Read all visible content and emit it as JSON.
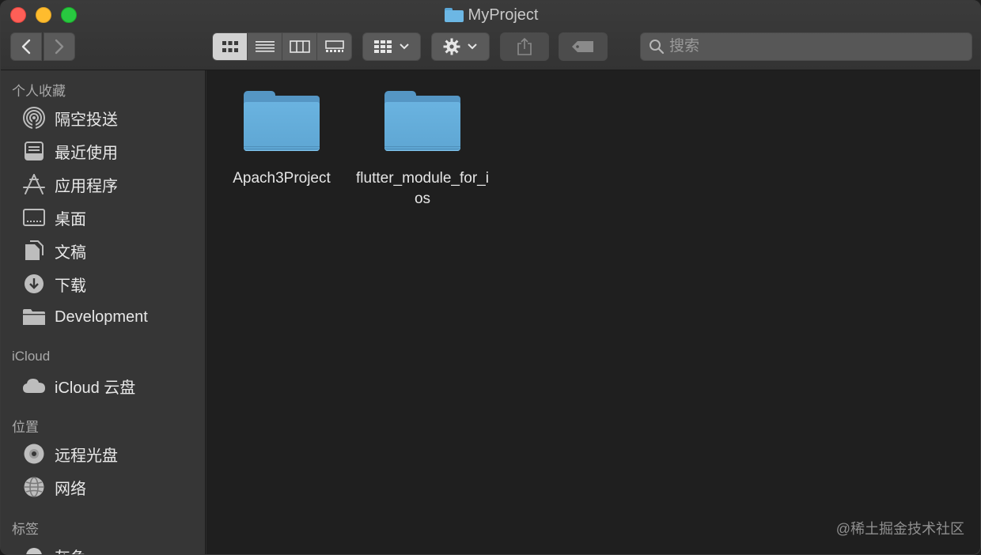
{
  "window": {
    "title": "MyProject"
  },
  "toolbar": {
    "back_icon": "chevron-left-icon",
    "forward_icon": "chevron-right-icon",
    "views": [
      "icon-view",
      "list-view",
      "column-view",
      "gallery-view"
    ],
    "active_view": "icon-view",
    "arrange_icon": "grid-icon",
    "action_icon": "gear-icon",
    "share_icon": "share-icon",
    "tag_icon": "tag-icon"
  },
  "search": {
    "placeholder": "搜索",
    "value": ""
  },
  "sidebar": {
    "favorites_title": "个人收藏",
    "favorites": [
      {
        "label": "隔空投送",
        "icon": "airdrop-icon"
      },
      {
        "label": "最近使用",
        "icon": "recents-icon"
      },
      {
        "label": "应用程序",
        "icon": "applications-icon"
      },
      {
        "label": "桌面",
        "icon": "desktop-icon"
      },
      {
        "label": "文稿",
        "icon": "documents-icon"
      },
      {
        "label": "下载",
        "icon": "downloads-icon"
      },
      {
        "label": "Development",
        "icon": "folder-icon"
      }
    ],
    "icloud_title": "iCloud",
    "icloud": [
      {
        "label": "iCloud 云盘",
        "icon": "cloud-icon"
      }
    ],
    "locations_title": "位置",
    "locations": [
      {
        "label": "远程光盘",
        "icon": "disc-icon"
      },
      {
        "label": "网络",
        "icon": "network-icon"
      }
    ],
    "tags_title": "标签",
    "tags": [
      {
        "label": "灰色",
        "icon": "tag-dot-icon"
      }
    ]
  },
  "files": [
    {
      "name": "Apach3Project",
      "icon": "folder-icon"
    },
    {
      "name": "flutter_module_for_ios",
      "icon": "folder-icon"
    }
  ],
  "watermark": "@稀土掘金技术社区",
  "colors": {
    "folder": "#6ab3e0",
    "close": "#fe5f57",
    "minimize": "#febc2e",
    "maximize": "#28c840"
  }
}
